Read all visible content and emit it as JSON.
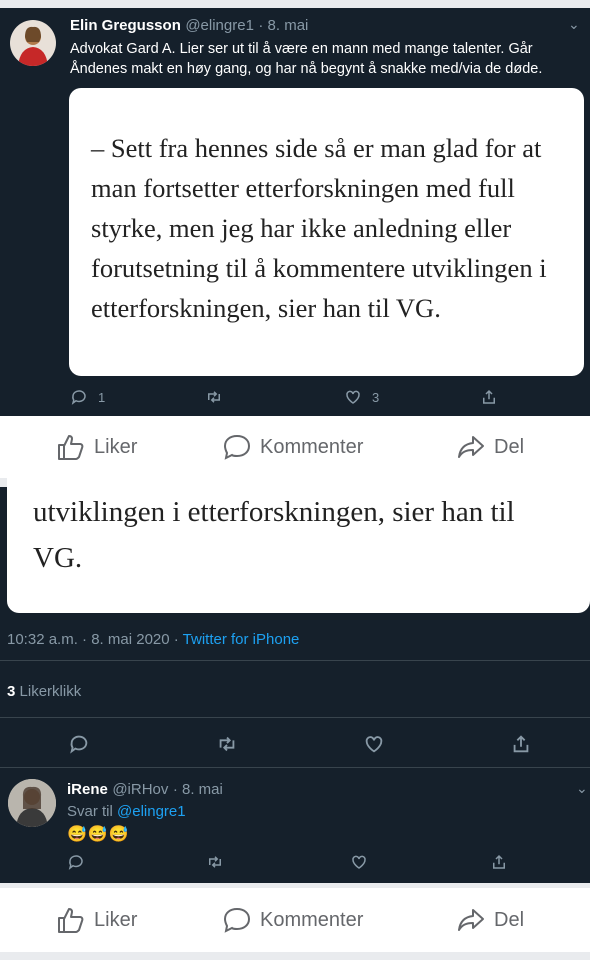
{
  "tweet1": {
    "author": "Elin Gregusson",
    "handle": "@elingre1",
    "date": "· 8. mai",
    "text": "Advokat Gard A. Lier ser ut til å være en mann med mange talenter. Går Åndenes makt en høy gang, og har nå begynt å snakke med/via de døde.",
    "quote": "– Sett fra hennes side så er man glad for at man fortsetter etterforskningen med full styrke, men jeg har ikke anledning eller forutsetning til å kommentere utviklingen i etterforskningen, sier han til VG.",
    "reply_count": "1",
    "like_count": "3"
  },
  "fb1": {
    "like": "Liker",
    "comment": "Kommenter",
    "share": "Del"
  },
  "detail": {
    "quote_tail": "utviklingen i etterforskningen, sier han til VG.",
    "time": "10:32 a.m. · 8. mai 2020 ·",
    "source": "Twitter for iPhone",
    "likes_number": "3",
    "likes_label": "Likerklikk"
  },
  "reply": {
    "author": "iRene",
    "handle": "@iRHov",
    "date": "· 8. mai",
    "reply_to_prefix": "Svar til",
    "reply_to_handle": "@elingre1",
    "emoji": "😅😅😅"
  },
  "fb2": {
    "like": "Liker",
    "comment": "Kommenter",
    "share": "Del"
  },
  "colors": {
    "twitter_bg": "#15202b",
    "link": "#1da1f2",
    "muted": "#8899a6"
  }
}
